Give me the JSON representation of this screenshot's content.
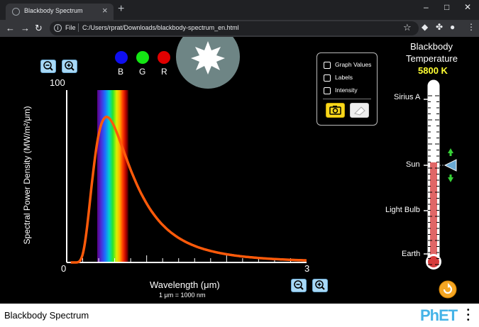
{
  "browser": {
    "tab_title": "Blackbody Spectrum",
    "tab_close": "×",
    "new_tab": "+",
    "minimize": "–",
    "maximize": "□",
    "close": "✕",
    "url_scheme": "File",
    "url": "C:/Users/rprat/Downloads/blackbody-spectrum_en.html"
  },
  "sim": {
    "filters": [
      "B",
      "G",
      "R"
    ],
    "filter_colors": [
      "#0f0ff0",
      "#14e614",
      "#e00000"
    ],
    "graph": {
      "y_max_label": "100",
      "y_axis_label": "Spectral Power Density (MW/m²/μm)",
      "x_min_label": "0",
      "x_max_label": "3",
      "x_axis_label": "Wavelength (μm)",
      "unit_note": "1 μm  =  1000 nm",
      "curve_color": "#ff5a0a"
    },
    "options": {
      "graph_values": "Graph Values",
      "labels": "Labels",
      "intensity": "Intensity"
    },
    "thermometer": {
      "title_line1": "Blackbody",
      "title_line2": "Temperature",
      "temperature": "5800 K",
      "temperature_color": "#ffff33",
      "marks": [
        "Sirius A",
        "Sun",
        "Light Bulb",
        "Earth"
      ],
      "fill_fraction": 0.56
    }
  },
  "footer": {
    "title": "Blackbody Spectrum",
    "logo": "PhET"
  }
}
